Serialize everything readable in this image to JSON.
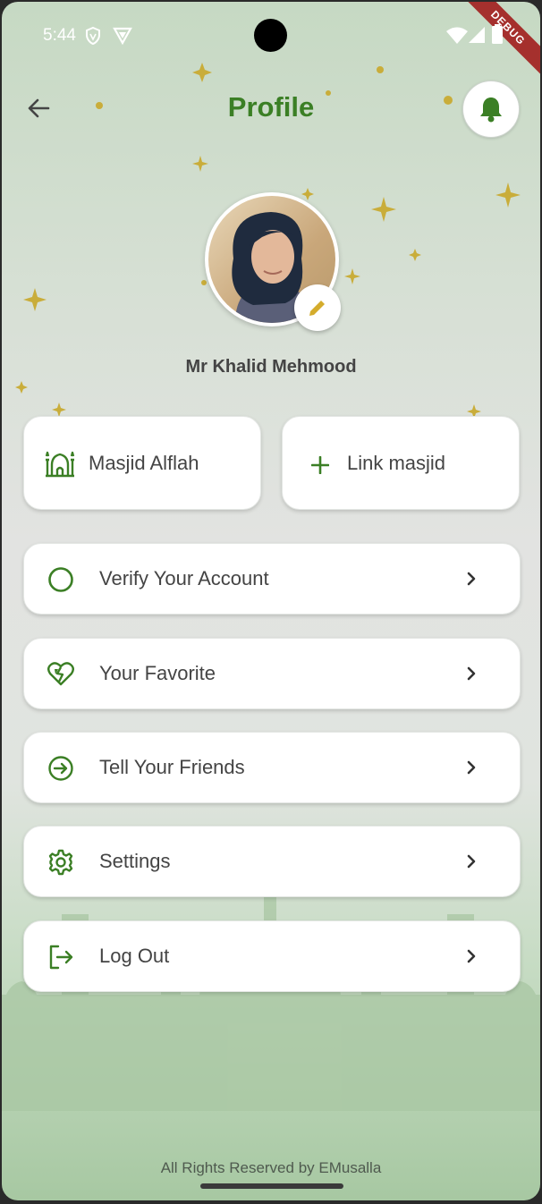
{
  "status_bar": {
    "time": "5:44",
    "debug_label": "DEBUG"
  },
  "header": {
    "title": "Profile"
  },
  "profile": {
    "name": "Mr Khalid Mehmood"
  },
  "quick_actions": [
    {
      "label": "Masjid Alflah",
      "icon": "mosque-icon"
    },
    {
      "label": "Link masjid",
      "icon": "plus-icon"
    }
  ],
  "menu": [
    {
      "label": "Verify Your Account",
      "icon": "circle-icon"
    },
    {
      "label": "Your Favorite",
      "icon": "broken-heart-icon"
    },
    {
      "label": "Tell Your Friends",
      "icon": "arrow-circle-icon"
    },
    {
      "label": "Settings",
      "icon": "gear-icon"
    },
    {
      "label": "Log Out",
      "icon": "logout-icon"
    }
  ],
  "footer": {
    "text": "All Rights Reserved by EMusalla"
  },
  "colors": {
    "accent": "#3b7f25",
    "gold": "#c9ad3a"
  }
}
